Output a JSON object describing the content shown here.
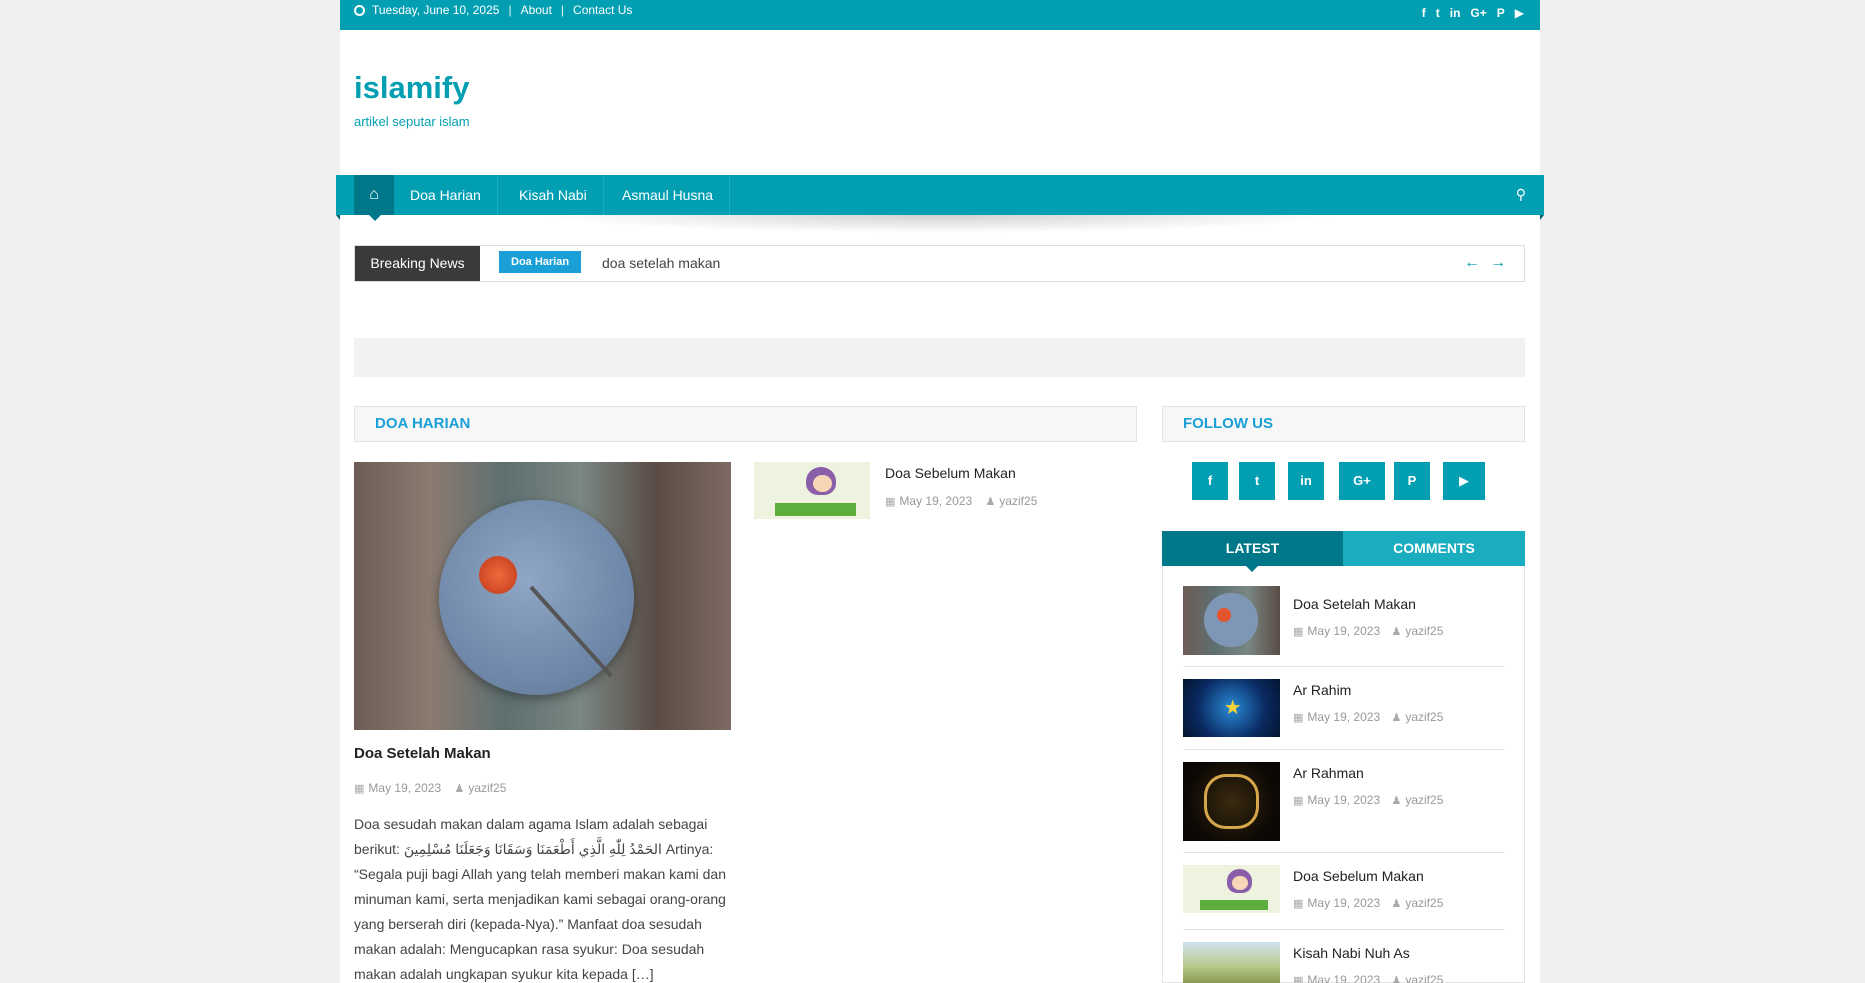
{
  "topbar": {
    "date": "Tuesday, June 10, 2025",
    "links": [
      "About",
      "Contact Us"
    ],
    "social_icons": [
      "facebook-icon",
      "twitter-icon",
      "linkedin-icon",
      "google-plus-icon",
      "pinterest-icon",
      "youtube-icon"
    ],
    "social_glyphs": [
      "f",
      "t",
      "in",
      "G+",
      "P",
      "▶"
    ]
  },
  "site": {
    "title": "islamify",
    "tagline": "artikel seputar islam"
  },
  "nav": {
    "items": [
      "Doa Harian",
      "Kisah Nabi",
      "Asmaul Husna"
    ]
  },
  "breaking": {
    "label": "Breaking News",
    "badge": "Doa Harian",
    "text": "doa setelah makan"
  },
  "section": {
    "title": "DOA HARIAN",
    "featured": {
      "title": "Doa Setelah Makan",
      "date": "May 19, 2023",
      "author": "yazif25",
      "excerpt": "  Doa sesudah makan dalam agama Islam adalah sebagai berikut: الحَمْدُ لِلّٰهِ الَّذِي أَطْعَمَنَا وَسَقَانَا وَجَعَلَنَا مُسْلِمِينَ Artinya: “Segala puji bagi Allah yang telah memberi makan kami dan minuman kami, serta menjadikan kami sebagai orang-orang yang berserah diri (kepada-Nya).” Manfaat doa sesudah makan adalah: Mengucapkan rasa syukur: Doa sesudah makan adalah ungkapan syukur kita kepada […]"
    },
    "side_item": {
      "title": "Doa Sebelum Makan",
      "date": "May 19, 2023",
      "author": "yazif25"
    }
  },
  "follow": {
    "title": "FOLLOW US",
    "buttons": [
      "f",
      "t",
      "in",
      "G+",
      "P",
      "▶"
    ]
  },
  "tabs": {
    "latest": "LATEST",
    "comments": "COMMENTS"
  },
  "latest": [
    {
      "title": "Doa Setelah Makan",
      "date": "May 19, 2023",
      "author": "yazif25"
    },
    {
      "title": "Ar Rahim",
      "date": "May 19, 2023",
      "author": "yazif25"
    },
    {
      "title": "Ar Rahman",
      "date": "May 19, 2023",
      "author": "yazif25"
    },
    {
      "title": "Doa Sebelum Makan",
      "date": "May 19, 2023",
      "author": "yazif25"
    },
    {
      "title": "Kisah Nabi Nuh As",
      "date": "May 19, 2023",
      "author": "yazif25"
    }
  ],
  "colors": {
    "brand": "#029fb2",
    "brand_dark": "#01788a",
    "badge": "#1a9fd6"
  }
}
